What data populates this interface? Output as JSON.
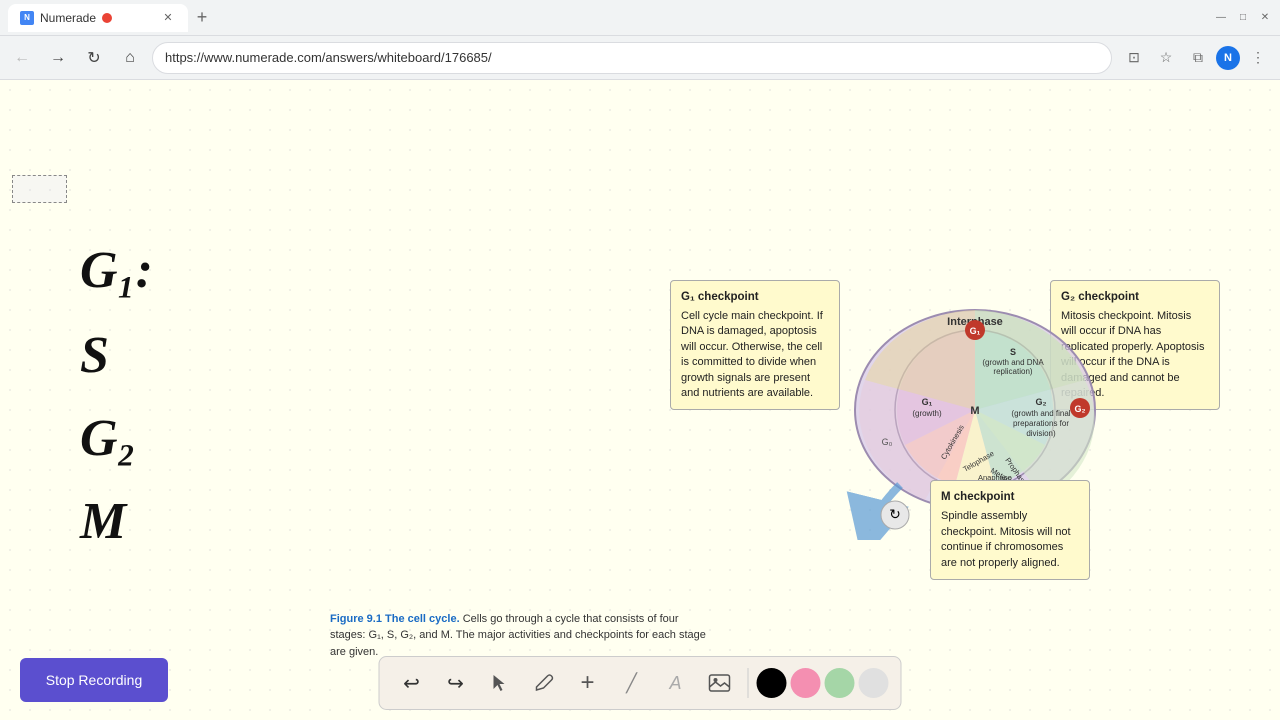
{
  "browser": {
    "tab_title": "Numerade",
    "tab_favicon": "N",
    "recording_dot": true,
    "url": "https://www.numerade.com/answers/whiteboard/176685/",
    "new_tab_label": "+",
    "nav": {
      "back": "←",
      "forward": "→",
      "refresh": "↻",
      "home": "⌂"
    },
    "window_controls": {
      "minimize": "—",
      "maximize": "□",
      "close": "✕"
    }
  },
  "toolbar": {
    "undo_label": "↩",
    "redo_label": "↪",
    "select_label": "▶",
    "pen_label": "✏",
    "add_label": "+",
    "eraser_label": "/",
    "text_label": "A",
    "image_label": "🖼",
    "colors": [
      "#000000",
      "#f48fb1",
      "#a5d6a7",
      "#e0e0e0"
    ],
    "stop_recording": "Stop Recording"
  },
  "handwritten": {
    "g1": "G₁:",
    "s": "S",
    "g2": "G₂",
    "m": "M"
  },
  "checkpoints": {
    "g1": {
      "title": "G₁ checkpoint",
      "text": "Cell cycle main checkpoint. If DNA is damaged, apoptosis will occur. Otherwise, the cell is committed to divide when growth signals are present and nutrients are available."
    },
    "g2": {
      "title": "G₂ checkpoint",
      "text": "Mitosis checkpoint. Mitosis will occur if DNA has replicated properly. Apoptosis will occur if the DNA is damaged and cannot be repaired."
    },
    "m": {
      "title": "M checkpoint",
      "text": "Spindle assembly checkpoint. Mitosis will not continue if chromosomes are not properly aligned."
    }
  },
  "figure": {
    "label": "Figure 9.1",
    "title": "The cell cycle.",
    "caption": "Cells go through a cycle that consists of four stages: G₁, S, G₂, and M. The major activities and checkpoints for each stage are given."
  },
  "diagram": {
    "interphase_label": "Interphase",
    "s_label": "S\n(growth and DNA\nreplication)",
    "g1_label": "G₁\n(growth)",
    "g2_label": "G₂\n(growth and final\npreparations for\ndivision)",
    "m_label": "M",
    "cytokinesis_label": "Cytokinesis",
    "telophase_label": "Telophase",
    "anaphase_label": "Anaphase",
    "metaphase_label": "Metaphase",
    "prophase_label": "Prophase"
  }
}
